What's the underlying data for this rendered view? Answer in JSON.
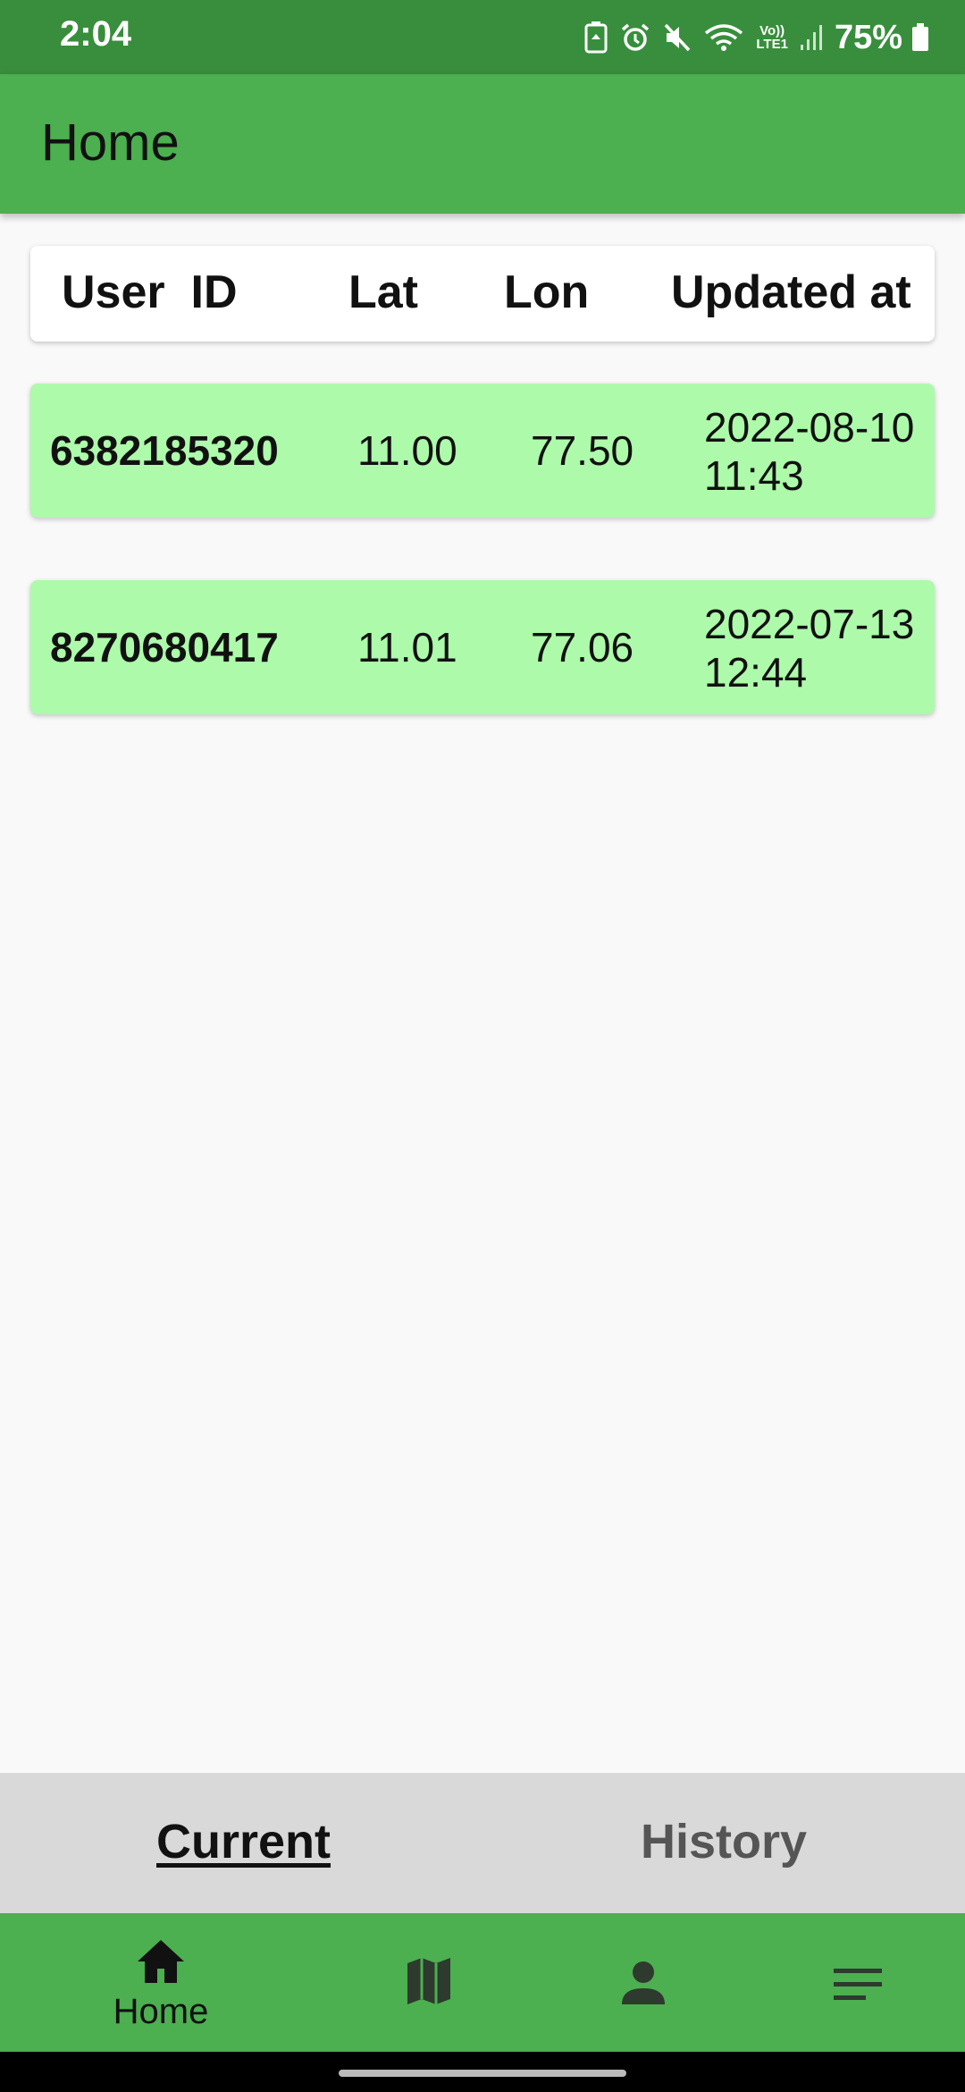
{
  "status_bar": {
    "time": "2:04",
    "battery": "75%",
    "icons": [
      "battery-saver-icon",
      "alarm-icon",
      "mute-icon",
      "wifi-icon",
      "volte-icon",
      "signal-icon",
      "battery-icon"
    ],
    "volte_label": "Vo))",
    "lte_label": "LTE1"
  },
  "app_bar": {
    "title": "Home"
  },
  "table": {
    "headers": [
      "User  ID",
      "Lat",
      "Lon",
      "Updated at"
    ],
    "rows": [
      {
        "user_id": "6382185320",
        "lat": "11.00",
        "lon": "77.50",
        "date": "2022-08-10",
        "time": "11:43"
      },
      {
        "user_id": "8270680417",
        "lat": "11.01",
        "lon": "77.06",
        "date": "2022-07-13",
        "time": "12:44"
      }
    ]
  },
  "tabs": {
    "current": "Current",
    "history": "History",
    "selected": "Current"
  },
  "bottom_nav": {
    "items": [
      {
        "icon": "home-icon",
        "label": "Home"
      },
      {
        "icon": "map-icon"
      },
      {
        "icon": "person-icon"
      },
      {
        "icon": "menu-icon"
      }
    ]
  },
  "colors": {
    "status_bar": "#388e3c",
    "primary": "#4caf50",
    "row_background": "#adfaab",
    "tab_bar": "#d9d9d9"
  }
}
